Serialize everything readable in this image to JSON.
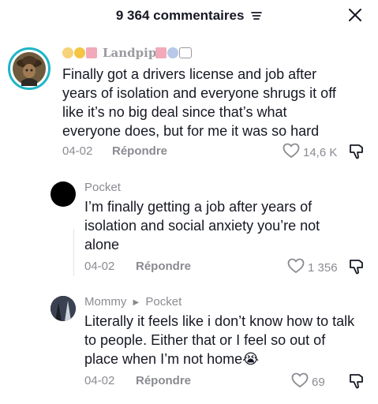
{
  "header": {
    "title": "9 364 commentaires"
  },
  "comments": [
    {
      "username": "Landpipe",
      "text": "Finally got a drivers license and job after years of isolation and everyone shrugs it off like it’s no big deal since that’s what everyone does, but for me it was so hard",
      "date": "04-02",
      "reply_label": "Répondre",
      "likes": "14,6 K"
    },
    {
      "username": "Pocket",
      "text": "I’m finally getting a job after years of isolation and social anxiety you’re not alone",
      "date": "04-02",
      "reply_label": "Répondre",
      "likes": "1 356"
    },
    {
      "username": "Mommy",
      "reply_to": "Pocket",
      "text": "Literally it feels like i don’t know how to talk to people. Either that or I feel so out of place when I’m not home",
      "emoji": "😭",
      "date": "04-02",
      "reply_label": "Répondre",
      "likes": "69"
    }
  ],
  "icons": {
    "sort": "sort-icon",
    "close": "close-icon",
    "heart": "heart-outline-icon",
    "dislike": "thumbs-down-icon"
  },
  "colors": {
    "text": "#161823",
    "muted": "#8a8b91",
    "avatar_ring": "#1fb5c6"
  }
}
